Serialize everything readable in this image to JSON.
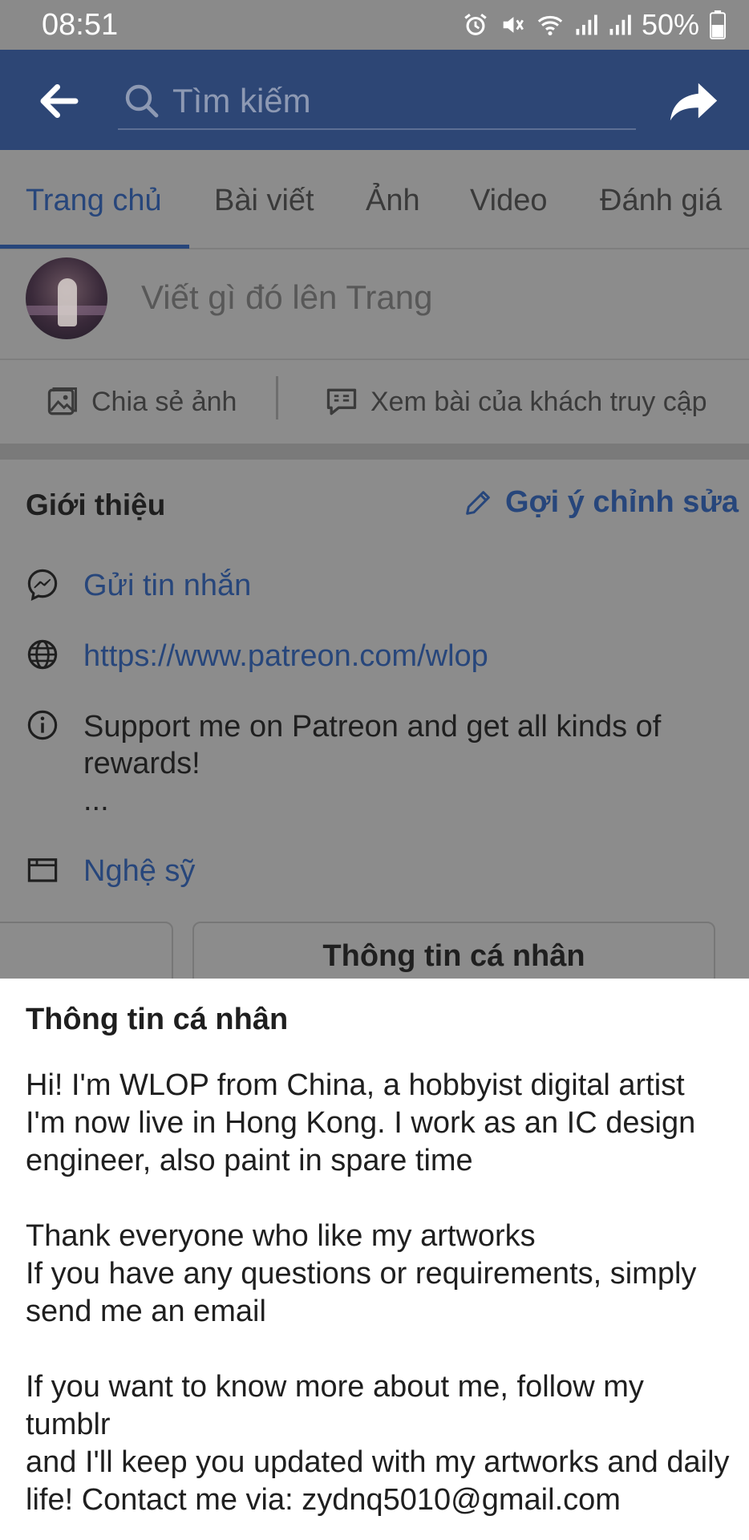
{
  "status_bar": {
    "time": "08:51",
    "battery": "50%",
    "icons": [
      "alarm-icon",
      "mute-icon",
      "wifi-icon",
      "signal-icon",
      "signal-icon",
      "battery-icon"
    ]
  },
  "app_bar": {
    "search_placeholder": "Tìm kiếm"
  },
  "tabs": [
    {
      "label": "Trang chủ",
      "active": true
    },
    {
      "label": "Bài viết",
      "active": false
    },
    {
      "label": "Ảnh",
      "active": false
    },
    {
      "label": "Video",
      "active": false
    },
    {
      "label": "Đánh giá",
      "active": false
    }
  ],
  "composer": {
    "placeholder": "Viết gì đó lên Trang"
  },
  "actions": {
    "share_photo": "Chia sẻ ảnh",
    "visitor_posts": "Xem bài của khách truy cập"
  },
  "intro": {
    "heading": "Giới thiệu",
    "suggest_edit": "Gợi ý chỉnh sửa",
    "send_message": "Gửi tin nhắn",
    "website": "https://www.patreon.com/wlop",
    "about_line": "Support me on Patreon and get all kinds of rewards!",
    "about_more": "...",
    "category": "Nghệ sỹ",
    "card_title": "Thông tin cá nhân"
  },
  "sheet": {
    "title": "Thông tin cá nhân",
    "body": "Hi! I'm WLOP from China, a hobbyist digital artist\nI'm now live in Hong Kong. I work as an IC design engineer, also paint in spare time\n\nThank everyone who like my artworks\nIf you have any questions or requirements, simply send me an email\n\nIf you want to know more about me, follow my tumblr\nand I'll keep you updated with my artworks and daily life! Contact me via: zydnq5010@gmail.com"
  },
  "colors": {
    "brand": "#2d4675",
    "link": "#27467b",
    "dim_overlay": "#8c8c8c"
  }
}
